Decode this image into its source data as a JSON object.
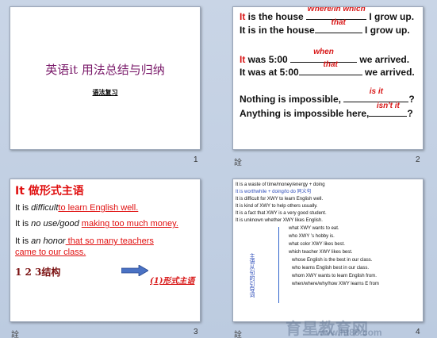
{
  "slides": [
    {
      "number": "1",
      "title": "英语it 用法总结与归纳",
      "subtitle": "语法复习"
    },
    {
      "number": "2",
      "note": "詮",
      "lines": [
        {
          "pre": "It",
          "mid": " is the house ",
          "answer": "Where/In which",
          "post": " I grow up."
        },
        {
          "pre": "",
          "mid": "It is in the  house",
          "answer": "that",
          "post": " I grow up."
        },
        {
          "pre": "It",
          "mid": " was 5:00 ",
          "answer": "when",
          "post": " we arrived."
        },
        {
          "pre": "",
          "mid": "It was at 5:00",
          "answer": "that",
          "post": " we arrived."
        },
        {
          "pre": "",
          "mid": "Nothing is impossible, ",
          "answer": "is it",
          "post": "?"
        },
        {
          "pre": "",
          "mid": "Anything  is  impossible here,",
          "answer": "isn't it",
          "post": "?"
        }
      ]
    },
    {
      "number": "3",
      "note": "詮",
      "title": "It 做形式主语",
      "lines": [
        {
          "a": "It is ",
          "b": "difficult",
          "c": "to learn English  well."
        },
        {
          "a": "It is ",
          "b": "no use/good",
          "c": "making too much money."
        },
        {
          "a": "It is ",
          "b": "an honor",
          "c": " that  so many teachers"
        },
        {
          "a": "",
          "b": "",
          "c": "came to our class."
        }
      ],
      "marks": "1      2        3结构",
      "form_label": "(1)形式主语"
    },
    {
      "number": "4",
      "note": "詮",
      "lines": [
        "It is a waste of time/money/energy  + doing",
        "It is worthwhile + doing/to do    同义句",
        "It is difficult for XWY to learn English well.",
        "It is kind      of XWY  to help others usually.",
        "It is a fact            that  XWY is a very good student.",
        "It is unknown  whether XWY likes English.",
        "what XWY wants to eat.",
        "who XWY ’s hobby is.",
        "what color XWY likes best.",
        "which teacher XWY likes best.",
        "whose English is the best in our class.",
        "who learns English best in our class.",
        "whom XWY wants to learn  English  from.",
        "when/where/why/how XWY learns E from"
      ],
      "vertical_label": "主语从句的引导词",
      "watermark": "育星教育网",
      "watermark_url": "www.ht88.com"
    }
  ]
}
